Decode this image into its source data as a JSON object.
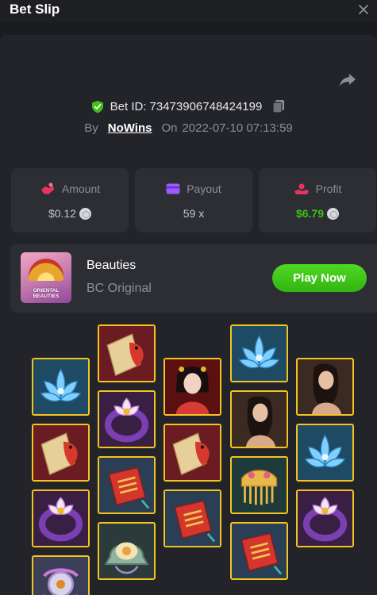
{
  "header": {
    "title": "Bet Slip"
  },
  "bet": {
    "id_label": "Bet ID:",
    "id_value": "73473906748424199",
    "by_label": "By",
    "user": "NoWins",
    "on_label": "On",
    "datetime": "2022-07-10 07:13:59"
  },
  "stats": {
    "amount": {
      "label": "Amount",
      "value": "$0.12"
    },
    "payout": {
      "label": "Payout",
      "value": "59 x"
    },
    "profit": {
      "label": "Profit",
      "value": "$6.79"
    }
  },
  "game": {
    "name": "Beauties",
    "provider": "BC Original",
    "thumb_caption_1": "ORIENTAL",
    "thumb_caption_2": "BEAUTIES",
    "play_label": "Play Now"
  },
  "reels": {
    "columns": [
      [
        "lotus",
        "scroll-fish",
        "ring",
        "lotus-sketch"
      ],
      [
        "scroll-fish",
        "ring",
        "book",
        "bell"
      ],
      [
        "geisha",
        "scroll-fish",
        "book"
      ],
      [
        "lotus",
        "beauty",
        "comb",
        "book"
      ],
      [
        "beauty",
        "lotus",
        "ring"
      ]
    ]
  },
  "colors": {
    "accent_green": "#3bc117",
    "tile_border": "#f4c41e",
    "panel": "#232429",
    "card": "#2d2e33"
  }
}
